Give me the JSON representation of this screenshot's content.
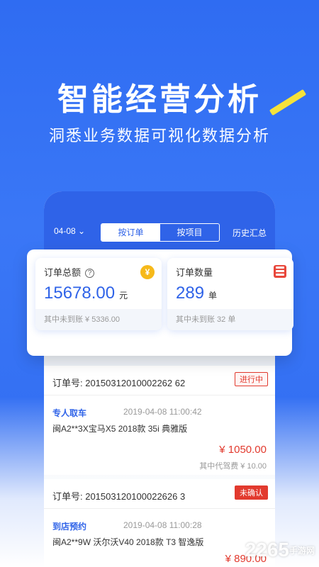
{
  "headline": "智能经营分析",
  "subline": "洞悉业务数据可视化数据分析",
  "topbar": {
    "date": "04-08",
    "tabs": [
      "按订单",
      "按项目"
    ],
    "history": "历史汇总"
  },
  "stats": [
    {
      "title": "订单总额",
      "value": "15678.00",
      "unit": "元",
      "foot": "其中未到账 ¥ 5336.00"
    },
    {
      "title": "订单数量",
      "value": "289",
      "unit": "单",
      "foot": "其中未到账 32 单"
    }
  ],
  "orders": [
    {
      "order_no": "订单号: 20150312010002262 62",
      "status": "进行中",
      "service": "专人取车",
      "time": "2019-04-08 11:00:42",
      "car": "闽A2**3X宝马X5 2018款 35i 典雅版",
      "price": "¥ 1050.00",
      "fee": "其中代驾费 ¥ 10.00"
    },
    {
      "order_no": "订单号: 201503120100022626 3",
      "status": "未确认",
      "service": "到店预约",
      "time": "2019-04-08 11:00:28",
      "car": "闽A2**9W 沃尔沃V40 2018款 T3 智逸版",
      "price": "¥ 890.00",
      "fee": ""
    }
  ],
  "watermark": {
    "brand": "2265",
    "site": "手游网"
  },
  "colors": {
    "primary": "#2f63e8",
    "danger": "#e23a2e",
    "accent_line": "#f5e23a",
    "coin": "#f6b91a"
  }
}
